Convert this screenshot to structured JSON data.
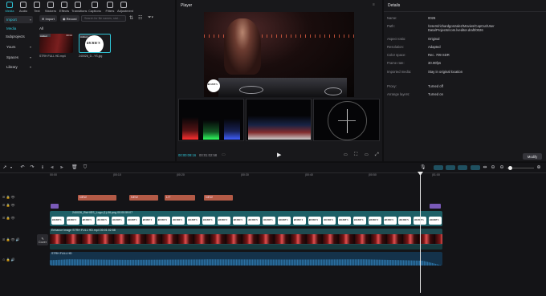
{
  "toolbar": {
    "items": [
      {
        "label": "Media",
        "icon": "media-icon"
      },
      {
        "label": "Audio",
        "icon": "audio-icon"
      },
      {
        "label": "Text",
        "icon": "text-icon"
      },
      {
        "label": "Stickers",
        "icon": "stickers-icon"
      },
      {
        "label": "Effects",
        "icon": "effects-icon"
      },
      {
        "label": "Transitions",
        "icon": "transitions-icon"
      },
      {
        "label": "Captions",
        "icon": "captions-icon"
      },
      {
        "label": "Filters",
        "icon": "filters-icon"
      },
      {
        "label": "Adjustment",
        "icon": "adjustment-icon"
      }
    ]
  },
  "sidebar": {
    "items": [
      {
        "label": "Import"
      },
      {
        "label": "Media"
      },
      {
        "label": "Subprojects"
      },
      {
        "label": "Yours"
      },
      {
        "label": "Spaces"
      },
      {
        "label": "Library"
      }
    ]
  },
  "media": {
    "import_label": "Import",
    "record_label": "Record",
    "search_placeholder": "Search for file names, stat...",
    "all_label": "All",
    "clips": [
      {
        "badge": "Added",
        "duration": "00:02",
        "name": "STRH FULL HD.mp4"
      },
      {
        "badge": "Added",
        "duration": "",
        "name": "240026_D...YS.jpg"
      }
    ],
    "logo_text": "RICHIE'S"
  },
  "player": {
    "title": "Player",
    "current_time": "00:00:09:16",
    "total_time": "00:01:02:58",
    "logo_text": "RICHIE'S"
  },
  "details": {
    "title": "Details",
    "rows": [
      {
        "key": "Name:",
        "value": "0026"
      },
      {
        "key": "Path:",
        "value": "/Users/richardgonzalez/Movies/CapCut/User Data/Projects/com.lveditor.draft/0026"
      },
      {
        "key": "Aspect ratio:",
        "value": "Original"
      },
      {
        "key": "Resolution:",
        "value": "Adapted"
      },
      {
        "key": "Color space:",
        "value": "Rec. 709 SDR"
      },
      {
        "key": "Frame rate:",
        "value": "30.00fps"
      },
      {
        "key": "Imported media:",
        "value": "Stay in original location"
      },
      {
        "key": "Proxy:",
        "value": "Turned off"
      },
      {
        "key": "Arrange layers:",
        "value": "Turned on"
      }
    ],
    "modify_label": "Modify"
  },
  "timeline": {
    "ruler": [
      "00:00",
      "|00:10",
      "|00:20",
      "|00:30",
      "|00:40",
      "|00:50",
      "|01:00"
    ],
    "text_clips": [
      "NEW",
      "NEW",
      "LIT",
      "NEW"
    ],
    "logo_track_label": "240026_RicHIES_Logo (1)-06.png  00:00:59:07",
    "logo_chip": "RICHIE'S",
    "video_track_label": "Enhance Image   STRH FULL HD.mp4   00:01:02:58",
    "audio_track_label": "STRH FULL HD",
    "cover_label": "Cover"
  },
  "colors": {
    "accent": "#2fc4d6",
    "text_clip": "#b35a46",
    "logo_track": "#1d5f66",
    "video_track": "#1f4a4f",
    "audio_wave": "#2b6fa0",
    "playhead": "#e8e8e8"
  }
}
